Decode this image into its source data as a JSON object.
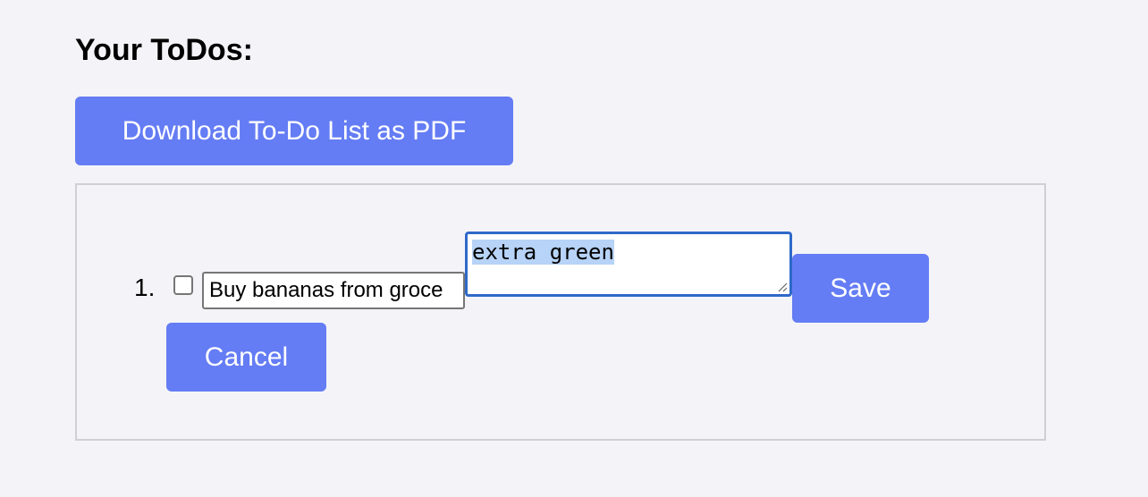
{
  "header": {
    "title": "Your ToDos:"
  },
  "toolbar": {
    "download_label": "Download To-Do List as PDF"
  },
  "todos": {
    "items": [
      {
        "number": "1.",
        "checked": false,
        "text_value": "Buy bananas from groce",
        "note_value": "extra green",
        "save_label": "Save",
        "cancel_label": "Cancel"
      }
    ]
  },
  "colors": {
    "button_bg": "#647cf4",
    "button_text": "#ffffff",
    "page_bg": "#f4f4f8",
    "focus_border": "#2f69c9",
    "selection": "#b7d3f7"
  },
  "icons": {
    "resize": "resize-grip-icon"
  }
}
